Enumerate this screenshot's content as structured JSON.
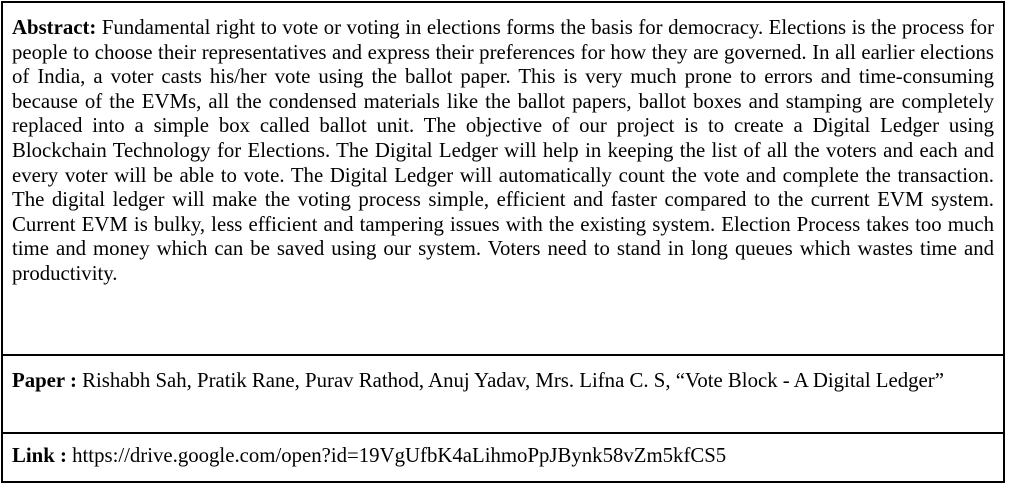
{
  "abstract": {
    "label": "Abstract:",
    "text": "Fundamental right to vote or voting in elections forms the basis for democracy. Elections is the process for people to choose their representatives and express their preferences for how they are governed. In all earlier elections of India, a voter casts his/her vote using the ballot paper. This is very much prone to errors and time-consuming because of the EVMs, all the condensed materials like the ballot papers, ballot boxes and stamping are completely replaced into a simple box called ballot unit. The objective of our project is to create a Digital Ledger using Blockchain Technology for Elections. The Digital Ledger will help in keeping the list of all the voters and each and every voter will be able to vote. The Digital Ledger will automatically count the vote and complete the transaction. The digital ledger will make the voting process simple, efficient and faster compared to the current EVM system. Current EVM is bulky, less efficient and tampering issues with the existing system. Election Process takes too much time and money which can be saved using our system. Voters need to stand in long queues which wastes time and productivity."
  },
  "paper": {
    "label": "Paper :",
    "text": "Rishabh Sah, Pratik Rane, Purav Rathod, Anuj Yadav, Mrs. Lifna C. S,  “Vote Block - A Digital Ledger”"
  },
  "link": {
    "label": "Link :",
    "url": "https://drive.google.com/open?id=19VgUfbK4aLihmoPpJBynk58vZm5kfCS5"
  }
}
